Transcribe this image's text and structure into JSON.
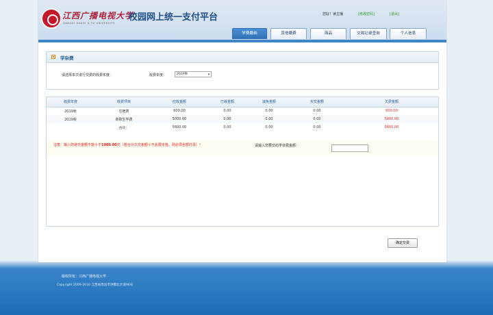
{
  "header": {
    "logo_cn": "江西广播电视大学",
    "logo_en": "JIANGXI RADIO & TV UNIVERSITY",
    "platform_title": "校园网上统一支付平台",
    "welcome": "您好！读主播",
    "link_edit": "[修改密码]",
    "link_logout": "[退出]"
  },
  "nav": {
    "tabs": [
      {
        "label": "学费缴纳",
        "active": true
      },
      {
        "label": "其他缴费",
        "active": false
      },
      {
        "label": "商品",
        "active": false
      },
      {
        "label": "交易记录查询",
        "active": false
      },
      {
        "label": "个人信息",
        "active": false
      }
    ]
  },
  "panel": {
    "title": "学杂费",
    "year_prompt": "请选择本次进行交费的收费年度：",
    "year_label": "收费年度：",
    "year_value": "2019秋"
  },
  "table": {
    "headers": [
      "收费年度",
      "收费项目",
      "应收金额",
      "已收金额",
      "减免金额",
      "实交金额",
      "欠费金额"
    ],
    "rows": [
      [
        "2019秋",
        "住宿费",
        "600.00",
        "0.00",
        "0.00",
        "0.00",
        "600.00"
      ],
      [
        "2019秋",
        "高职生学费",
        "5000.00",
        "0.00",
        "0.00",
        "0.00",
        "5000.00"
      ]
    ],
    "total": [
      "合计：",
      "5600.00",
      "0.00",
      "0.00",
      "0.00",
      "5600.00"
    ]
  },
  "notice": {
    "prefix": "注意：输入的待交金额不能小于",
    "amount": "1000.00",
    "suffix": "元（若合计欠交金额小于此限定值，则必须全部付清）！",
    "pay_label": "请输入您要交的学杂费金额：",
    "pay_value": ""
  },
  "confirm_label": "确定交费",
  "footer": {
    "line1": "版权所有：江西广播电视大学",
    "line2": "Copyright 2009-2016 江西省南昌市洪都北大道96号"
  },
  "colors": {
    "accent": "#2f70b4",
    "danger": "#e02020",
    "link": "#3aa02c"
  }
}
